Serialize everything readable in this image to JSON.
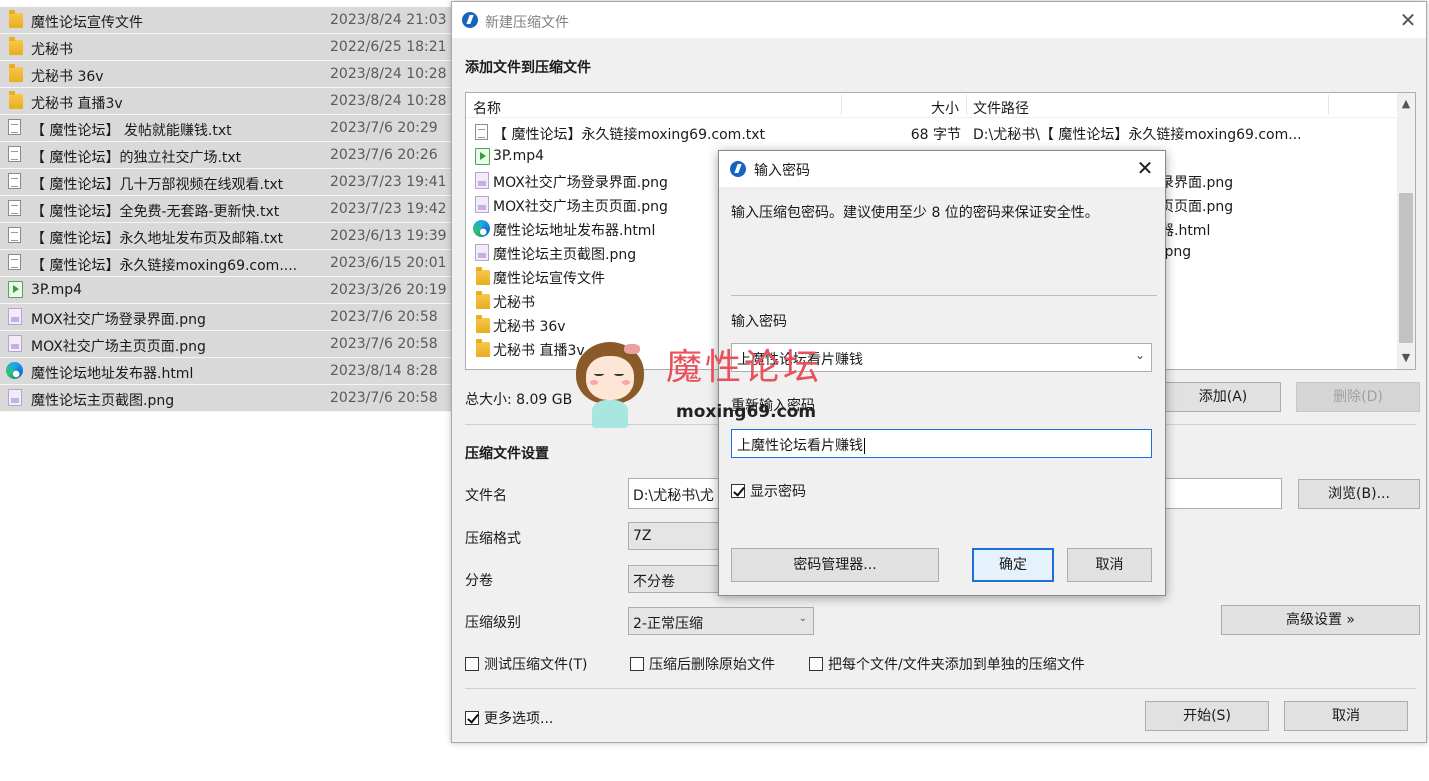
{
  "explorer": {
    "rows": [
      {
        "name": "魔性论坛宣传文件",
        "date": "2023/8/24 21:03",
        "icon": "folder-icon"
      },
      {
        "name": "尤秘书",
        "date": "2022/6/25 18:21",
        "icon": "folder-icon"
      },
      {
        "name": "尤秘书 36v",
        "date": "2023/8/24 10:28",
        "icon": "folder-icon"
      },
      {
        "name": "尤秘书 直播3v",
        "date": "2023/8/24 10:28",
        "icon": "folder-icon"
      },
      {
        "name": "【 魔性论坛】 发帖就能赚钱.txt",
        "date": "2023/7/6 20:29",
        "icon": "text-file-icon"
      },
      {
        "name": "【 魔性论坛】的独立社交广场.txt",
        "date": "2023/7/6 20:26",
        "icon": "text-file-icon"
      },
      {
        "name": "【 魔性论坛】几十万部视频在线观看.txt",
        "date": "2023/7/23 19:41",
        "icon": "text-file-icon"
      },
      {
        "name": "【 魔性论坛】全免费-无套路-更新快.txt",
        "date": "2023/7/23 19:42",
        "icon": "text-file-icon"
      },
      {
        "name": "【 魔性论坛】永久地址发布页及邮箱.txt",
        "date": "2023/6/13 19:39",
        "icon": "text-file-icon"
      },
      {
        "name": "【 魔性论坛】永久链接moxing69.com....",
        "date": "2023/6/15 20:01",
        "icon": "text-file-icon"
      },
      {
        "name": "3P.mp4",
        "date": "2023/3/26 20:19",
        "icon": "video-file-icon"
      },
      {
        "name": "MOX社交广场登录界面.png",
        "date": "2023/7/6 20:58",
        "icon": "image-file-icon"
      },
      {
        "name": "MOX社交广场主页页面.png",
        "date": "2023/7/6 20:58",
        "icon": "image-file-icon"
      },
      {
        "name": "魔性论坛地址发布器.html",
        "date": "2023/8/14 8:28",
        "icon": "edge-browser-icon"
      },
      {
        "name": "魔性论坛主页截图.png",
        "date": "2023/7/6 20:58",
        "icon": "image-file-icon"
      }
    ]
  },
  "main_dialog": {
    "title": "新建压缩文件",
    "add_section_title": "添加文件到压缩文件",
    "columns": {
      "name": "名称",
      "size": "大小",
      "path": "文件路径"
    },
    "files": [
      {
        "name": "【 魔性论坛】永久链接moxing69.com.txt",
        "size": "68 字节",
        "path": "D:\\尤秘书\\【 魔性论坛】永久链接moxing69.com...",
        "icon": "text-file-icon"
      },
      {
        "name": "3P.mp4",
        "size": "",
        "path": "",
        "icon": "video-file-icon"
      },
      {
        "name": "MOX社交广场登录界面.png",
        "size": "",
        "path": "录界面.png",
        "icon": "image-file-icon"
      },
      {
        "name": "MOX社交广场主页页面.png",
        "size": "",
        "path": "页页面.png",
        "icon": "image-file-icon"
      },
      {
        "name": "魔性论坛地址发布器.html",
        "size": "",
        "path": "器.html",
        "icon": "edge-browser-icon"
      },
      {
        "name": "魔性论坛主页截图.png",
        "size": "",
        "path": ".png",
        "icon": "image-file-icon"
      },
      {
        "name": "魔性论坛宣传文件",
        "size": "",
        "path": "",
        "icon": "folder-icon"
      },
      {
        "name": "尤秘书",
        "size": "",
        "path": "",
        "icon": "folder-icon"
      },
      {
        "name": "尤秘书 36v",
        "size": "",
        "path": "",
        "icon": "folder-icon"
      },
      {
        "name": "尤秘书 直播3v",
        "size": "",
        "path": "",
        "icon": "folder-icon"
      }
    ],
    "total_size": "总大小: 8.09 GB",
    "add_button": "添加(A)",
    "delete_button": "删除(D)",
    "settings_title": "压缩文件设置",
    "filename_label": "文件名",
    "filename_value": "D:\\尤秘书\\尤",
    "browse_button": "浏览(B)...",
    "format_label": "压缩格式",
    "format_value": "7Z",
    "split_label": "分卷",
    "split_value": "不分卷",
    "level_label": "压缩级别",
    "level_value": "2-正常压缩",
    "advanced_button": "高级设置 »",
    "test_checkbox": "测试压缩文件(T)",
    "delete_after_checkbox": "压缩后删除原始文件",
    "separate_checkbox": "把每个文件/文件夹添加到单独的压缩文件",
    "more_options_checkbox": "更多选项...",
    "more_options_checked": true,
    "start_button": "开始(S)",
    "cancel_button": "取消"
  },
  "password_dialog": {
    "title": "输入密码",
    "hint": "输入压缩包密码。建议使用至少 8 位的密码来保证安全性。",
    "password_label": "输入密码",
    "password_value": "上魔性论坛看片赚钱",
    "confirm_label": "重新输入密码",
    "confirm_value": "上魔性论坛看片赚钱",
    "show_password_label": "显示密码",
    "show_password_checked": true,
    "manager_button": "密码管理器...",
    "ok_button": "确定",
    "cancel_button": "取消"
  },
  "watermark": {
    "title": "魔性论坛",
    "url": "moxing69.com"
  }
}
